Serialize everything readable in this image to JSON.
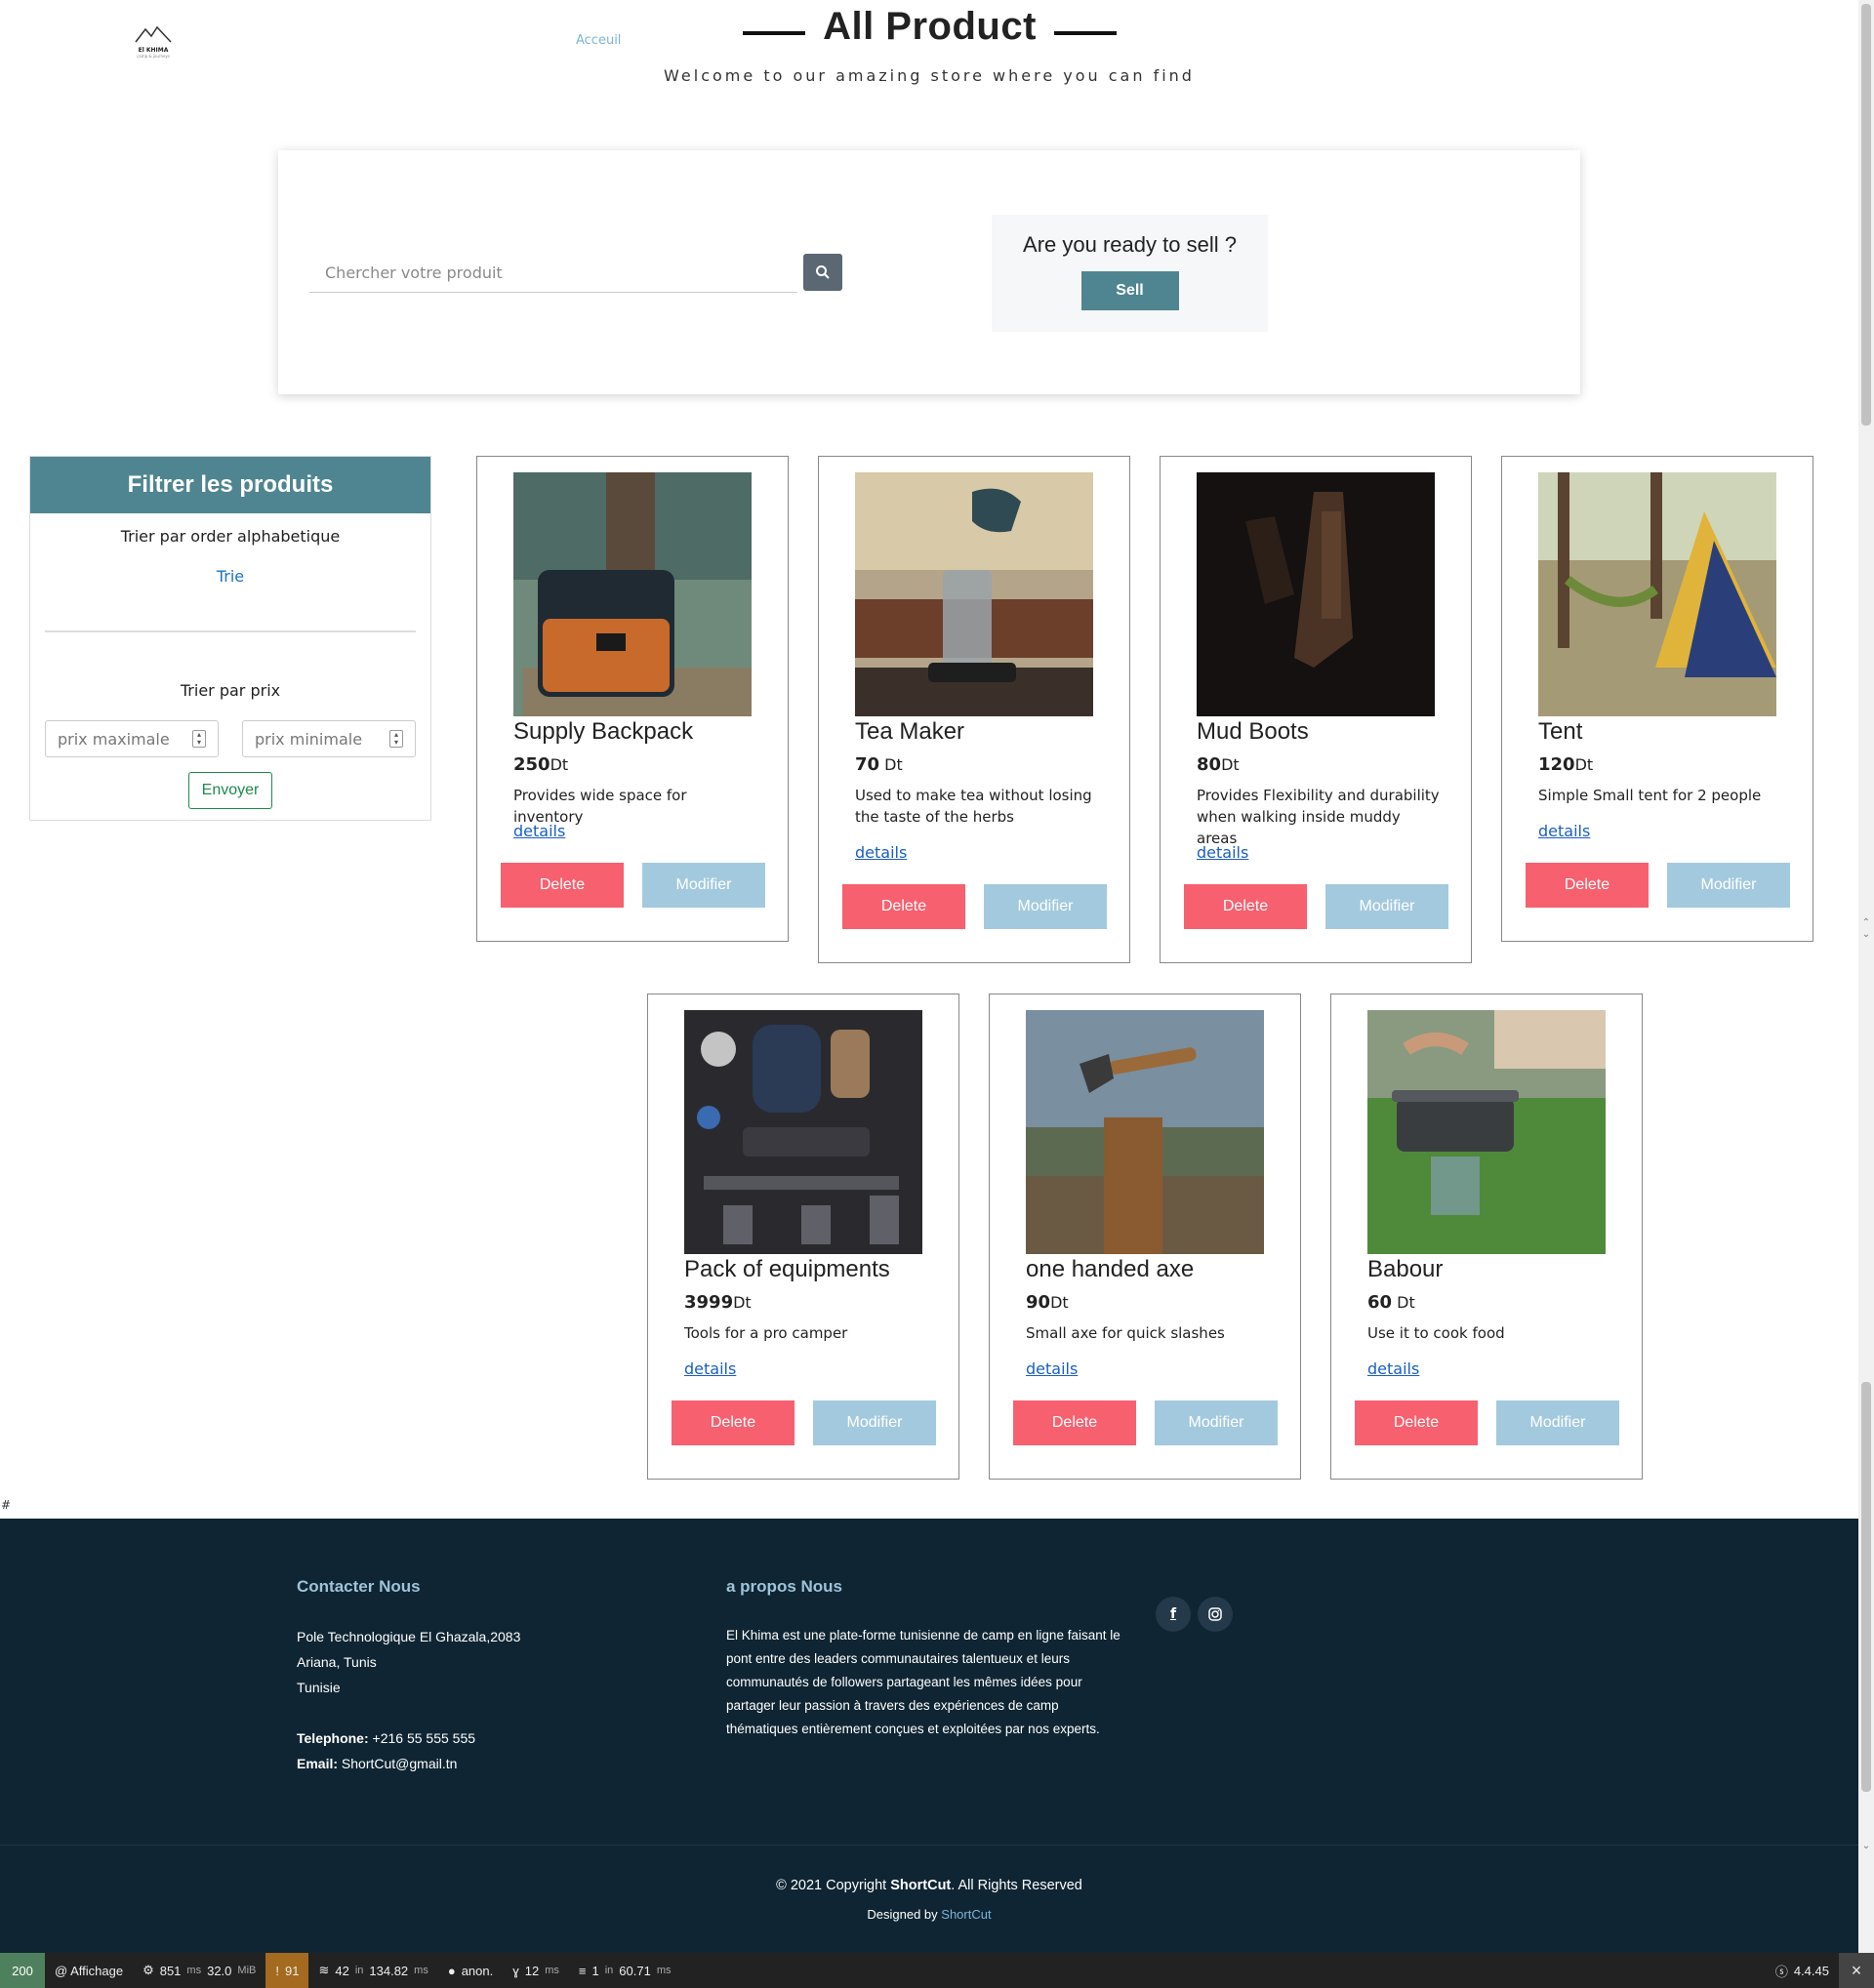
{
  "header": {
    "logo_text": "El KHIMA",
    "logo_sub": "camp & journeys",
    "nav_home": "Acceuil",
    "title": "All Product",
    "subtitle": "Welcome to our amazing store where you can find"
  },
  "search": {
    "placeholder": "Chercher votre produit",
    "sell_question": "Are you ready to sell ?",
    "sell_button": "Sell"
  },
  "filter": {
    "title": "Filtrer les produits",
    "sort_alpha_label": "Trier par order alphabetique",
    "sort_alpha_link": "Trie",
    "sort_price_label": "Trier par prix",
    "max_price_placeholder": "prix maximale",
    "min_price_placeholder": "prix minimale",
    "submit": "Envoyer"
  },
  "card_labels": {
    "details": "details",
    "delete": "Delete",
    "modify": "Modifier"
  },
  "products": [
    {
      "name": "Supply Backpack",
      "price": "250",
      "currency": "Dt",
      "description": "Provides wide space for inventory"
    },
    {
      "name": "Tea Maker",
      "price": "70",
      "currency": " Dt",
      "description": "Used to make tea without losing the taste of the herbs"
    },
    {
      "name": "Mud Boots",
      "price": "80",
      "currency": "Dt",
      "description": "Provides Flexibility and durability when walking inside muddy areas"
    },
    {
      "name": "Tent",
      "price": "120",
      "currency": "Dt",
      "description": "Simple Small tent for 2 people"
    },
    {
      "name": "Pack of equipments",
      "price": "3999",
      "currency": "Dt",
      "description": "Tools for a pro camper"
    },
    {
      "name": "one handed axe",
      "price": "90",
      "currency": "Dt",
      "description": "Small axe for quick slashes"
    },
    {
      "name": "Babour",
      "price": "60",
      "currency": " Dt",
      "description": "Use it to cook food"
    }
  ],
  "stray_text": "#",
  "footer": {
    "contact_title": "Contacter Nous",
    "address_line1": "Pole Technologique El Ghazala,2083",
    "address_line2": "Ariana, Tunis",
    "address_line3": "Tunisie",
    "phone_label": "Telephone:",
    "phone_value": "+216 55 555 555",
    "email_label": "Email:",
    "email_value": "ShortCut@gmail.tn",
    "about_title": "a propos Nous",
    "about_text": "El Khima est une plate-forme tunisienne de camp en ligne faisant le pont entre des leaders communautaires talentueux et leurs communautés de followers partageant les mêmes idées pour partager leur passion à travers des expériences de camp thématiques entièrement conçues et exploitées par nos experts.",
    "copyright_prefix": "© 2021 Copyright ",
    "copyright_brand": "ShortCut",
    "copyright_suffix": ". All Rights Reserved",
    "designed_prefix": "Designed by ",
    "designed_brand": "ShortCut"
  },
  "toolbar": {
    "status": "200",
    "route": "@ Affichage",
    "time": "851",
    "time_unit": "ms",
    "memory": "32.0",
    "memory_unit": "MiB",
    "warnings": "91",
    "queries_count": "42",
    "queries_time": "134.82",
    "user": "anon.",
    "render_time": "12",
    "cache_count": "1",
    "cache_time": "60.71",
    "in": "in",
    "version": "4.4.45"
  },
  "colors": {
    "teal": "#4f8590",
    "delete": "#f7606f",
    "modify": "#a3c9de",
    "footer_bg": "#0f2533",
    "link": "#1a5fc2"
  }
}
